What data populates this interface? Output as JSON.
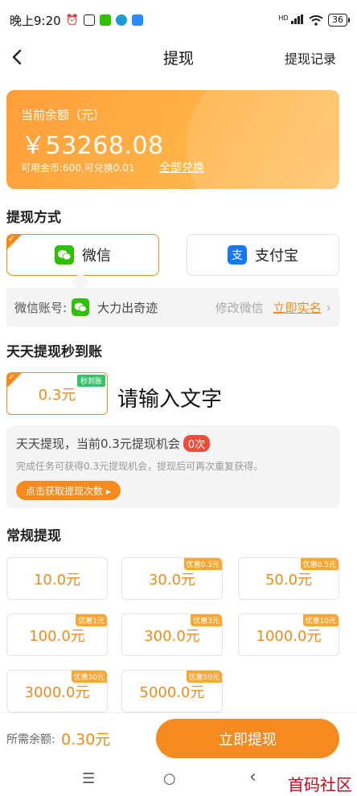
{
  "status_bar": {
    "time": "晚上9:20",
    "signal": "HD",
    "battery": "36"
  },
  "header": {
    "back_icon": "chevron-left-icon",
    "title": "提现",
    "right_link": "提现记录"
  },
  "balance": {
    "label": "当前余额（元）",
    "amount": "￥53268.08",
    "sub": "可用金币:600,可兑换0.01",
    "exchange_link": "全部兑换"
  },
  "method": {
    "section_title": "提现方式",
    "wechat_label": "微信",
    "alipay_label": "支付宝",
    "account_label": "微信账号:",
    "account_name": "大力出奇迹",
    "edit_link": "修改微信",
    "verify_link": "立即实名",
    "chevron": "›"
  },
  "daily": {
    "section_title": "天天提现秒到账",
    "amount": "0.3元",
    "tag": "秒到账",
    "placeholder_text": "请输入文字",
    "info_title": "天天提现，当前0.3元提现机会",
    "badge": "0次",
    "desc": "完成任务可获得0.3元提现机会，提现后可再次重复获得。",
    "get_button": "点击获取提现次数 ▸"
  },
  "regular": {
    "section_title": "常规提现",
    "options": [
      {
        "amount": "10.0元",
        "promo": ""
      },
      {
        "amount": "30.0元",
        "promo": "优惠0.3元"
      },
      {
        "amount": "50.0元",
        "promo": "优惠0.5元"
      },
      {
        "amount": "100.0元",
        "promo": "优惠1元"
      },
      {
        "amount": "300.0元",
        "promo": "优惠3元"
      },
      {
        "amount": "1000.0元",
        "promo": "优惠10元"
      },
      {
        "amount": "3000.0元",
        "promo": "优惠30元"
      },
      {
        "amount": "5000.0元",
        "promo": "优惠50元"
      }
    ]
  },
  "bottom": {
    "required_label": "所需余额:",
    "required_value": "0.30元",
    "submit": "立即提现"
  },
  "sysnav": {
    "menu": "☰",
    "home": "○",
    "back": "‹"
  },
  "watermark": "首码社区",
  "colors": {
    "accent": "#f58a1f",
    "badge_red": "#f04a3a",
    "wechat_green": "#2dc100",
    "alipay_blue": "#1677ff"
  }
}
